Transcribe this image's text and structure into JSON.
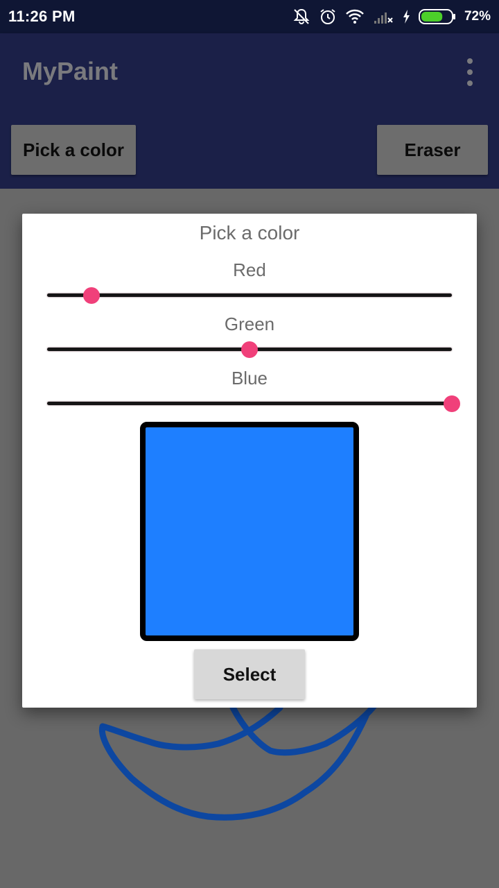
{
  "status_bar": {
    "time": "11:26 PM",
    "battery_percent": "72%",
    "battery_level": 0.72,
    "icons": [
      "bell-off-icon",
      "alarm-icon",
      "wifi-icon",
      "cell-signal-icon",
      "charging-bolt-icon",
      "battery-icon"
    ]
  },
  "app_bar": {
    "title": "MyPaint",
    "menu_icon": "overflow-menu-icon"
  },
  "toolbar": {
    "pick_color_label": "Pick a color",
    "eraser_label": "Eraser"
  },
  "dialog": {
    "title": "Pick a color",
    "sliders": [
      {
        "label": "Red",
        "value": 0.11
      },
      {
        "label": "Green",
        "value": 0.5
      },
      {
        "label": "Blue",
        "value": 1.0
      }
    ],
    "preview_color": "#1e7fff",
    "select_label": "Select"
  },
  "colors": {
    "status_bar": "#0f1634",
    "app_bar": "#1b2048",
    "slider_thumb": "#f0407a",
    "stroke": "#0d47a1",
    "canvas_dim": "#686868"
  }
}
